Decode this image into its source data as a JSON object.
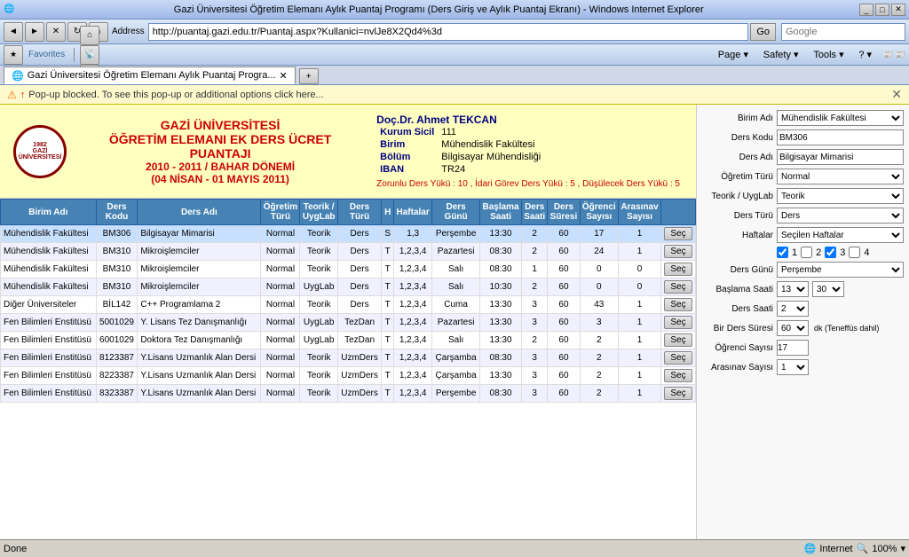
{
  "window": {
    "title": "Gazi Üniversitesi Öğretim Elemanı Aylık Puantaj Programı (Ders Giriş ve Aylık Puantaj Ekranı) - Windows Internet Explorer",
    "address": "http://puantaj.gazi.edu.tr/Puantaj.aspx?Kullanici=nvlJe8X2Qd4%3d",
    "search_placeholder": "Google",
    "status": "Done"
  },
  "tabs": [
    {
      "label": "Gazi Üniversitesi Öğretim Elemanı Aylık Puantaj Progra..."
    }
  ],
  "popup_bar": {
    "message": "Pop-up blocked. To see this pop-up or additional options click here..."
  },
  "header": {
    "logo_text": "1982\nGAZİ\nÜNİVERSİTESİ",
    "title1": "GAZİ ÜNİVERSİTESİ",
    "title2": "ÖĞRETİM ELEMANI EK DERS ÜCRET PUANTAJI",
    "title3": "2010 - 2011 / BAHAR DÖNEMİ",
    "title4": "(04 NİSAN - 01 MAYIS 2011)"
  },
  "user": {
    "name": "Doç.Dr. Ahmet TEKCAN",
    "sicil_label": "Kurum Sicil",
    "sicil_value": "111",
    "birim_label": "Birim",
    "birim_value": "Mühendislik Fakültesi",
    "bolum_label": "Bölüm",
    "bolum_value": "Bilgisayar Mühendisliği",
    "iban_label": "IBAN",
    "iban_value": "TR24",
    "ders_yuku": "Zorunlu Ders Yükü : 10 , İdari Görev Ders Yükü : 5 , Düşülecek Ders Yükü : 5"
  },
  "table": {
    "headers": [
      "Birim Adı",
      "Ders\nKodu",
      "Ders Adı",
      "Öğretim\nTürü",
      "Teorik /\nUygLab",
      "Ders\nTürü",
      "H",
      "Haftalar",
      "Ders\nGünü",
      "Başlama\nSaati",
      "Ders\nSaati",
      "Ders\nSüresi",
      "Öğrenci\nSayısı",
      "Arasınav\nSayısı",
      ""
    ],
    "rows": [
      {
        "birim": "Mühendislik Fakültesi",
        "kod": "BM306",
        "ders": "Bilgisayar Mimarisi",
        "ogretim": "Normal",
        "teorik": "Teorik",
        "tur": "Ders",
        "h": "S",
        "haftalar": "1,3",
        "gun": "Perşembe",
        "baslama": "13:30",
        "saat": "2",
        "sure": "60",
        "ogrenci": "17",
        "arasinav": "1",
        "selected": true
      },
      {
        "birim": "Mühendislik Fakültesi",
        "kod": "BM310",
        "ders": "Mikroişlemciler",
        "ogretim": "Normal",
        "teorik": "Teorik",
        "tur": "Ders",
        "h": "T",
        "haftalar": "1,2,3,4",
        "gun": "Pazartesi",
        "baslama": "08:30",
        "saat": "2",
        "sure": "60",
        "ogrenci": "24",
        "arasinav": "1",
        "selected": false
      },
      {
        "birim": "Mühendislik Fakültesi",
        "kod": "BM310",
        "ders": "Mikroişlemciler",
        "ogretim": "Normal",
        "teorik": "Teorik",
        "tur": "Ders",
        "h": "T",
        "haftalar": "1,2,3,4",
        "gun": "Salı",
        "baslama": "08:30",
        "saat": "1",
        "sure": "60",
        "ogrenci": "0",
        "arasinav": "0",
        "selected": false
      },
      {
        "birim": "Mühendislik Fakültesi",
        "kod": "BM310",
        "ders": "Mikroişlemciler",
        "ogretim": "Normal",
        "teorik": "UygLab",
        "tur": "Ders",
        "h": "T",
        "haftalar": "1,2,3,4",
        "gun": "Salı",
        "baslama": "10:30",
        "saat": "2",
        "sure": "60",
        "ogrenci": "0",
        "arasinav": "0",
        "selected": false
      },
      {
        "birim": "Diğer Üniversiteler",
        "kod": "BİL142",
        "ders": "C++ Programlama 2",
        "ogretim": "Normal",
        "teorik": "Teorik",
        "tur": "Ders",
        "h": "T",
        "haftalar": "1,2,3,4",
        "gun": "Cuma",
        "baslama": "13:30",
        "saat": "3",
        "sure": "60",
        "ogrenci": "43",
        "arasinav": "1",
        "selected": false
      },
      {
        "birim": "Fen Bilimleri Enstitüsü",
        "kod": "5001029",
        "ders": "Y. Lisans Tez Danışmanlığı",
        "ogretim": "Normal",
        "teorik": "UygLab",
        "tur": "TezDan",
        "h": "T",
        "haftalar": "1,2,3,4",
        "gun": "Pazartesi",
        "baslama": "13:30",
        "saat": "3",
        "sure": "60",
        "ogrenci": "3",
        "arasinav": "1",
        "selected": false
      },
      {
        "birim": "Fen Bilimleri Enstitüsü",
        "kod": "6001029",
        "ders": "Doktora Tez Danışmanlığı",
        "ogretim": "Normal",
        "teorik": "UygLab",
        "tur": "TezDan",
        "h": "T",
        "haftalar": "1,2,3,4",
        "gun": "Salı",
        "baslama": "13:30",
        "saat": "2",
        "sure": "60",
        "ogrenci": "2",
        "arasinav": "1",
        "selected": false
      },
      {
        "birim": "Fen Bilimleri Enstitüsü",
        "kod": "8123387",
        "ders": "Y.Lisans Uzmanlık Alan Dersi",
        "ogretim": "Normal",
        "teorik": "Teorik",
        "tur": "UzmDers",
        "h": "T",
        "haftalar": "1,2,3,4",
        "gun": "Çarşamba",
        "baslama": "08:30",
        "saat": "3",
        "sure": "60",
        "ogrenci": "2",
        "arasinav": "1",
        "selected": false
      },
      {
        "birim": "Fen Bilimleri Enstitüsü",
        "kod": "8223387",
        "ders": "Y.Lisans Uzmanlık Alan Dersi",
        "ogretim": "Normal",
        "teorik": "Teorik",
        "tur": "UzmDers",
        "h": "T",
        "haftalar": "1,2,3,4",
        "gun": "Çarşamba",
        "baslama": "13:30",
        "saat": "3",
        "sure": "60",
        "ogrenci": "2",
        "arasinav": "1",
        "selected": false
      },
      {
        "birim": "Fen Bilimleri Enstitüsü",
        "kod": "8323387",
        "ders": "Y.Lisans Uzmanlık Alan Dersi",
        "ogretim": "Normal",
        "teorik": "Teorik",
        "tur": "UzmDers",
        "h": "T",
        "haftalar": "1,2,3,4",
        "gun": "Perşembe",
        "baslama": "08:30",
        "saat": "3",
        "sure": "60",
        "ogrenci": "2",
        "arasinav": "1",
        "selected": false
      }
    ]
  },
  "right_panel": {
    "birim_adi_label": "Birim Adı",
    "birim_adi_value": "Mühendislik Fakültesi",
    "ders_kodu_label": "Ders Kodu",
    "ders_kodu_value": "BM306",
    "ders_adi_label": "Ders Adı",
    "ders_adi_value": "Bilgisayar Mimarisi",
    "ogretim_turu_label": "Öğretim Türü",
    "ogretim_turu_value": "Normal",
    "teorik_label": "Teorik / UygLab",
    "teorik_value": "Teorik",
    "ders_turu_label": "Ders Türü",
    "ders_turu_value": "Ders",
    "haftalar_label": "Haftalar",
    "haftalar_value": "Seçilen Haftalar",
    "cb1": "1",
    "cb2": "2",
    "cb3": "3",
    "cb4": "4",
    "ders_gunu_label": "Ders Günü",
    "ders_gunu_value": "Perşembe",
    "baslama_label": "Başlama Saati",
    "baslama_h": "13",
    "baslama_m": "30",
    "ders_saati_label": "Ders Saati",
    "ders_saati_value": "2",
    "bir_ders_label": "Bir Ders Süresi",
    "bir_ders_value": "60",
    "dk_text": "dk (Teneffüs dahil)",
    "ogrenci_label": "Öğrenci Sayısı",
    "ogrenci_value": "17",
    "arasinav_label": "Arasınav Sayısı",
    "arasinav_value": "1",
    "sec_btn": "Seç"
  },
  "icons": {
    "back": "◄",
    "forward": "►",
    "stop": "✕",
    "refresh": "↻",
    "home": "⌂",
    "search": "🔍",
    "favorites": "★",
    "tools": "⚙",
    "close": "✕",
    "info": "ℹ"
  }
}
